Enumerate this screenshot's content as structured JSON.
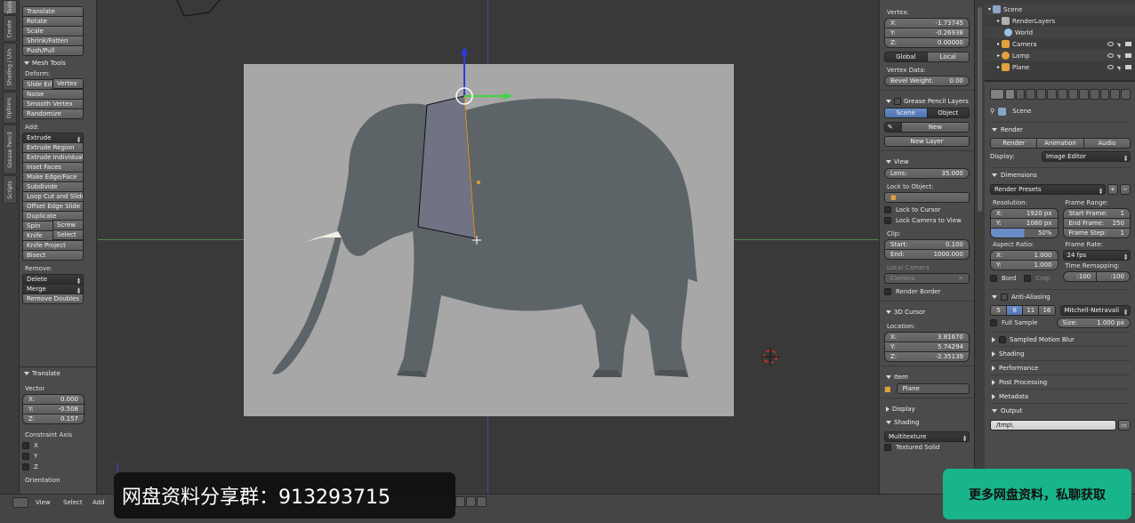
{
  "vtabs": [
    "Tools",
    "Create",
    "Shading / UVs",
    "Options",
    "Grease Pencil",
    "Scripts"
  ],
  "toolshelf": {
    "transform_items": [
      "Translate",
      "Rotate",
      "Scale",
      "Shrink/Fatten",
      "Push/Pull"
    ],
    "mesh_tools_header": "Mesh Tools",
    "deform_label": "Deform:",
    "slide_edge": "Slide Ed",
    "vertex": "Vertex",
    "noise": "Noise",
    "smooth_vertex": "Smooth Vertex",
    "randomize": "Randomize",
    "add_label": "Add:",
    "extrude": "Extrude",
    "add_items": [
      "Extrude Region",
      "Extrude Individual",
      "Inset Faces",
      "Make Edge/Face",
      "Subdivide",
      "Loop Cut and Slide",
      "Offset Edge Slide",
      "Duplicate"
    ],
    "spin": "Spin",
    "screw": "Screw",
    "knife": "Knife",
    "select": "Select",
    "knife_project": "Knife Project",
    "bisect": "Bisect",
    "remove_label": "Remove:",
    "delete": "Delete",
    "merge": "Merge",
    "remove_doubles": "Remove Doubles",
    "translate_header": "Translate",
    "vector_label": "Vector",
    "vector": [
      {
        "axis": "X:",
        "value": "0.000"
      },
      {
        "axis": "Y:",
        "value": "-0.508"
      },
      {
        "axis": "Z:",
        "value": "0.157"
      }
    ],
    "constraint_label": "Constraint Axis",
    "constraint": [
      "X",
      "Y",
      "Z"
    ],
    "orientation_label": "Orientation"
  },
  "npanel": {
    "vertex_label": "Vertex:",
    "vertex": [
      {
        "axis": "X:",
        "value": "-1.73745"
      },
      {
        "axis": "Y:",
        "value": "-0.26938"
      },
      {
        "axis": "Z:",
        "value": "0.00000"
      }
    ],
    "global": "Global",
    "local": "Local",
    "vertex_data_label": "Vertex Data:",
    "bevel_weight_label": "Bevel Weight:",
    "bevel_weight_value": "0.00",
    "grease_pencil_header": "Grease Pencil Layers",
    "scene": "Scene",
    "object": "Object",
    "new": "New",
    "new_layer": "New Layer",
    "view_header": "View",
    "lens_label": "Lens:",
    "lens_value": "35.000",
    "lock_to_object_label": "Lock to Object:",
    "lock_to_cursor": "Lock to Cursor",
    "lock_camera_to_view": "Lock Camera to View",
    "clip_label": "Clip:",
    "clip_start_label": "Start:",
    "clip_start_value": "0.100",
    "clip_end_label": "End:",
    "clip_end_value": "1000.000",
    "local_camera_label": "Local Camera",
    "camera_field": "Camera",
    "render_border": "Render Border",
    "cursor_header": "3D Cursor",
    "location_label": "Location:",
    "location": [
      {
        "axis": "X:",
        "value": "3.81670"
      },
      {
        "axis": "Y:",
        "value": "5.74294"
      },
      {
        "axis": "Z:",
        "value": "-2.35139"
      }
    ],
    "item_header": "Item",
    "item_name": "Plane",
    "display_header": "Display",
    "shading_header": "Shading",
    "multitexture": "Multitexture",
    "textured_solid": "Textured Solid"
  },
  "outliner": {
    "rows": [
      {
        "name": "Scene",
        "indent": 0,
        "color": "#8aa6c8"
      },
      {
        "name": "RenderLayers",
        "indent": 1,
        "color": "#b0b0b0"
      },
      {
        "name": "World",
        "indent": 1,
        "color": "#9cc2e6"
      },
      {
        "name": "Camera",
        "indent": 1,
        "color": "#e2a13c"
      },
      {
        "name": "Lamp",
        "indent": 1,
        "color": "#e2a13c"
      },
      {
        "name": "Plane",
        "indent": 1,
        "color": "#e2a13c"
      }
    ]
  },
  "props": {
    "scene": "Scene",
    "render_header": "Render",
    "render_btn": "Render",
    "animation_btn": "Animation",
    "audio_btn": "Audio",
    "display_label": "Display:",
    "display_value": "Image Editor",
    "dimensions_header": "Dimensions",
    "render_presets": "Render Presets",
    "resolution_label": "Resolution:",
    "res_x_label": "X:",
    "res_x": "1920 px",
    "res_y_label": "Y:",
    "res_y": "1080 px",
    "res_pct": "50%",
    "frame_range_label": "Frame Range:",
    "start_frame_label": "Start Frame:",
    "start_frame": "1",
    "end_frame_label": "End Frame:",
    "end_frame": "250",
    "frame_step_label": "Frame Step:",
    "frame_step": "1",
    "aspect_label": "Aspect Ratio:",
    "aspect_x_label": "X:",
    "aspect_x": "1.000",
    "aspect_y_label": "Y:",
    "aspect_y": "1.000",
    "frame_rate_label": "Frame Rate:",
    "frame_rate": "24 fps",
    "time_remap_label": "Time Remapping:",
    "time_remap_old": ":100",
    "time_remap_new": ":100",
    "bord": "Bord",
    "crop": "Crop",
    "aa_header": "Anti-Aliasing",
    "aa_samples": [
      "5",
      "8",
      "11",
      "16"
    ],
    "aa_filter": "Mitchell-Netravali",
    "full_sample": "Full Sample",
    "size_label": "Size:",
    "size_value": "1.000 px",
    "collapsed": [
      "Sampled Motion Blur",
      "Shading",
      "Performance",
      "Post Processing",
      "Metadata"
    ],
    "output_header": "Output",
    "output_path": "/tmp\\"
  },
  "header": {
    "view": "View",
    "select": "Select",
    "add": "Add"
  },
  "overlay": {
    "left": "网盘资料分享群：913293715",
    "right": "更多网盘资料，私聊获取"
  }
}
